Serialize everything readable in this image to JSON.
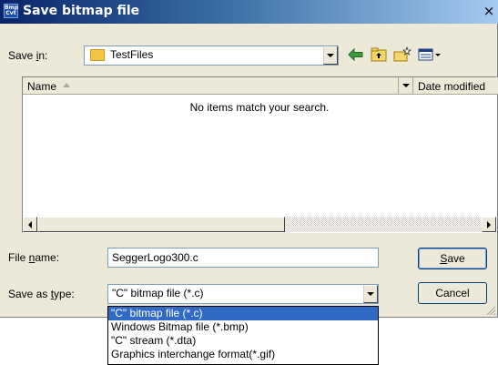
{
  "window": {
    "title": "Save bitmap file",
    "app_icon_text": "Bmp Cvt",
    "close_glyph": "×"
  },
  "save_in": {
    "label_prefix": "Save ",
    "label_accel": "i",
    "label_suffix": "n:",
    "value": "TestFiles",
    "folder_icon": "folder-icon"
  },
  "toolbar": {
    "icons": [
      "back-arrow-icon",
      "up-folder-icon",
      "new-folder-icon",
      "view-menu-icon"
    ]
  },
  "listview": {
    "columns": [
      {
        "label": "Name",
        "sort": "ascending"
      },
      {
        "label": "Date modified"
      }
    ],
    "empty_message": "No items match your search."
  },
  "file_name": {
    "label_prefix": "File ",
    "label_accel": "n",
    "label_suffix": "ame:",
    "value": "SeggerLogo300.c"
  },
  "save_as_type": {
    "label_prefix": "Save as ",
    "label_accel": "t",
    "label_suffix": "ype:",
    "value": "\"C\" bitmap file (*.c)",
    "options": [
      "\"C\" bitmap file (*.c)",
      "Windows Bitmap file (*.bmp)",
      "\"C\" stream (*.dta)",
      "Graphics interchange format(*.gif)"
    ],
    "selected_index": 0
  },
  "buttons": {
    "save_prefix": "",
    "save_accel": "S",
    "save_suffix": "ave",
    "cancel": "Cancel"
  },
  "colors": {
    "title_gradient_start": "#0a246a",
    "dialog_bg": "#ece9d8",
    "selection": "#316ac5"
  }
}
